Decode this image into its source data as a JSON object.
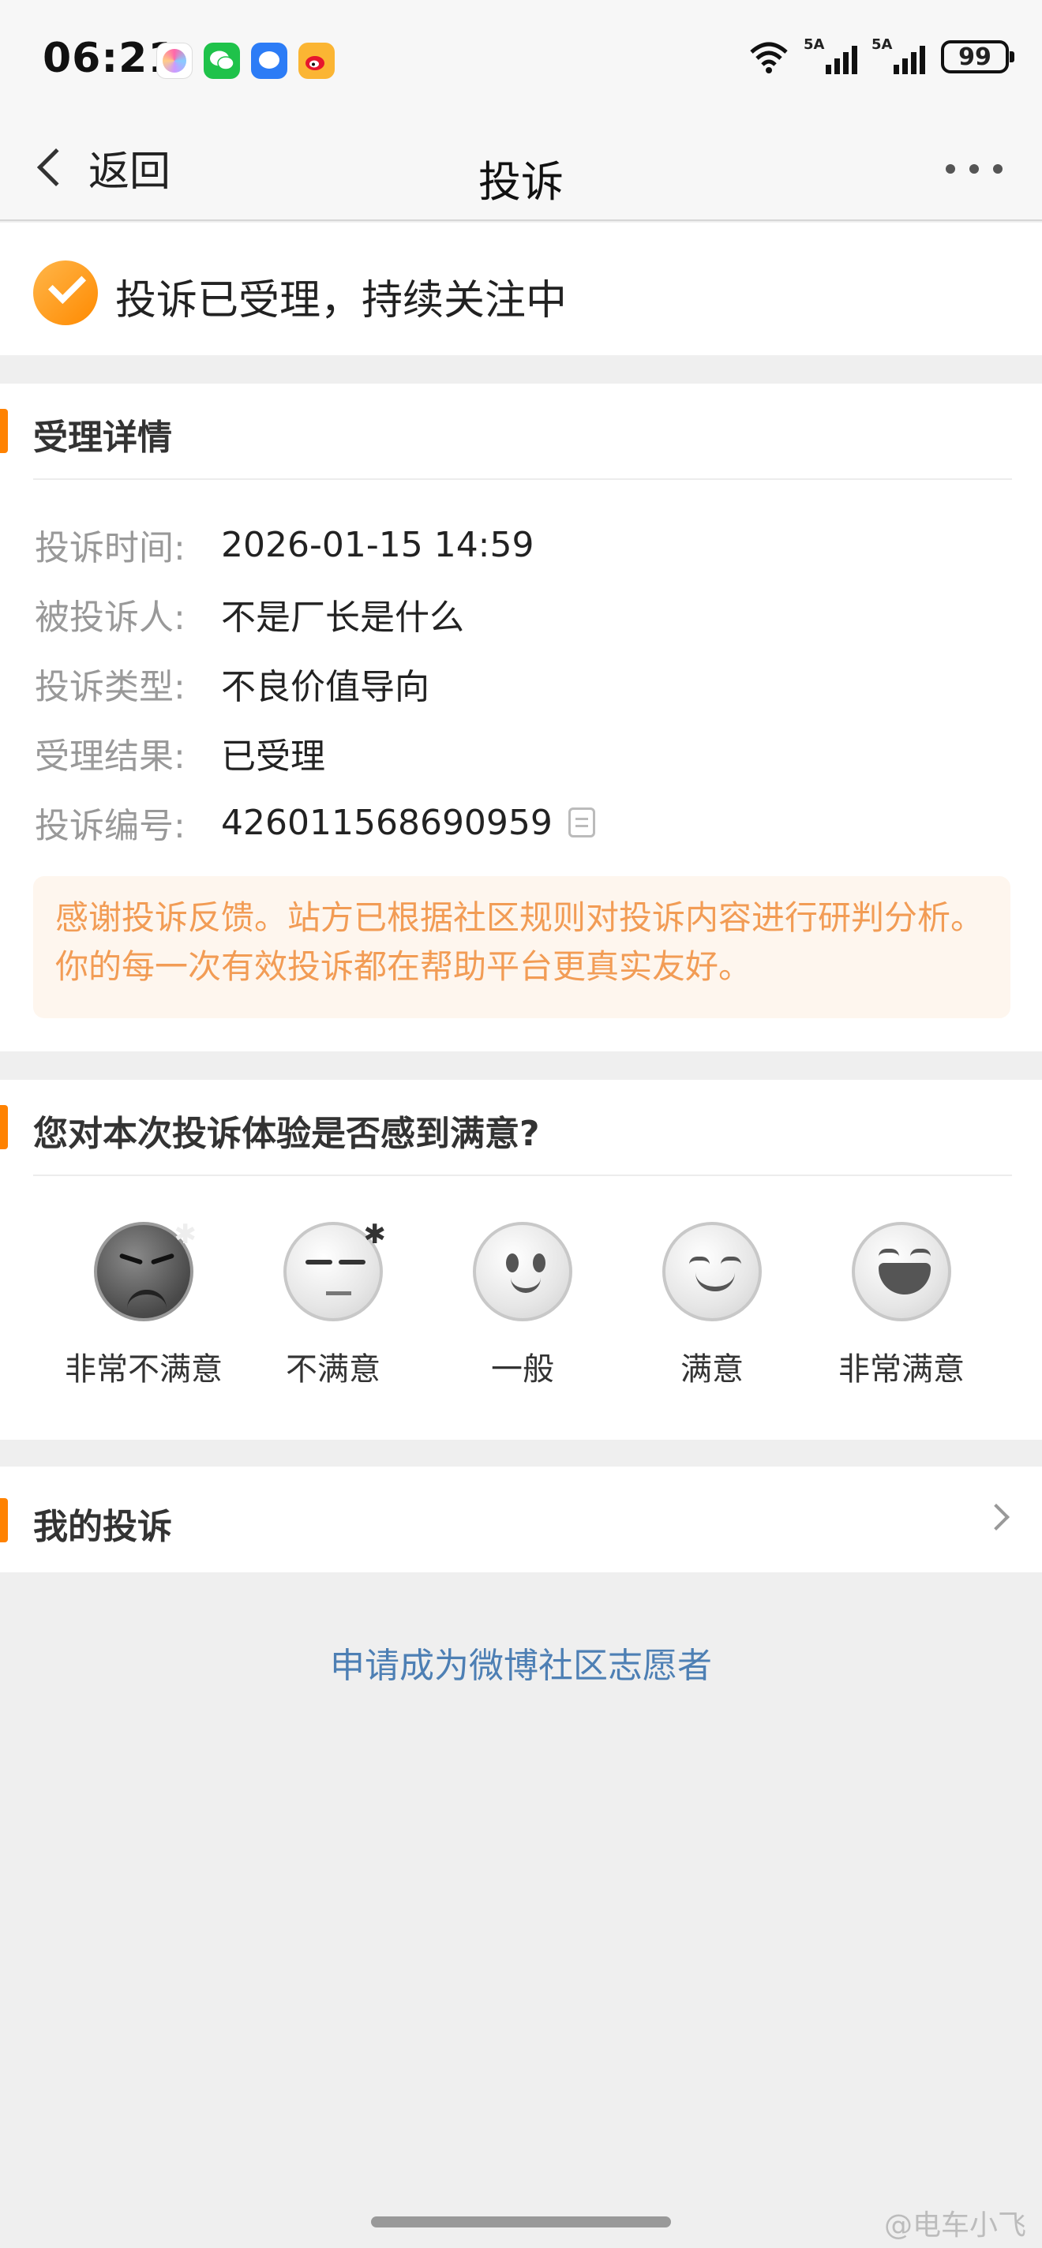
{
  "status_bar": {
    "time": "06:21",
    "battery": "99",
    "signal_tags": [
      "5A",
      "5A"
    ],
    "apps": [
      "assistant-app-icon",
      "wechat-icon",
      "messages-icon",
      "weibo-icon"
    ]
  },
  "nav": {
    "back_label": "返回",
    "title": "投诉",
    "more_icon": "more-dots-icon"
  },
  "banner": {
    "text": "投诉已受理，持续关注中",
    "icon": "check-circle-icon"
  },
  "details": {
    "title": "受理详情",
    "rows": [
      {
        "label": "投诉时间:",
        "value": "2026-01-15 14:59"
      },
      {
        "label": "被投诉人:",
        "value": "不是厂长是什么"
      },
      {
        "label": "投诉类型:",
        "value": "不良价值导向"
      },
      {
        "label": "受理结果:",
        "value": "已受理"
      },
      {
        "label": "投诉编号:",
        "value": "426011568690959"
      }
    ],
    "notice": "感谢投诉反馈。站方已根据社区规则对投诉内容进行研判分析。你的每一次有效投诉都在帮助平台更真实友好。"
  },
  "satisfaction": {
    "title": "您对本次投诉体验是否感到满意?",
    "options": [
      "非常不满意",
      "不满意",
      "一般",
      "满意",
      "非常满意"
    ]
  },
  "mine": {
    "title": "我的投诉"
  },
  "volunteer_link": "申请成为微博社区志愿者",
  "watermark": "@电车小飞",
  "colors": {
    "accent": "#ff8200",
    "link": "#4d7fb4",
    "notice_text": "#f29c55",
    "notice_bg": "#fef6ee"
  }
}
